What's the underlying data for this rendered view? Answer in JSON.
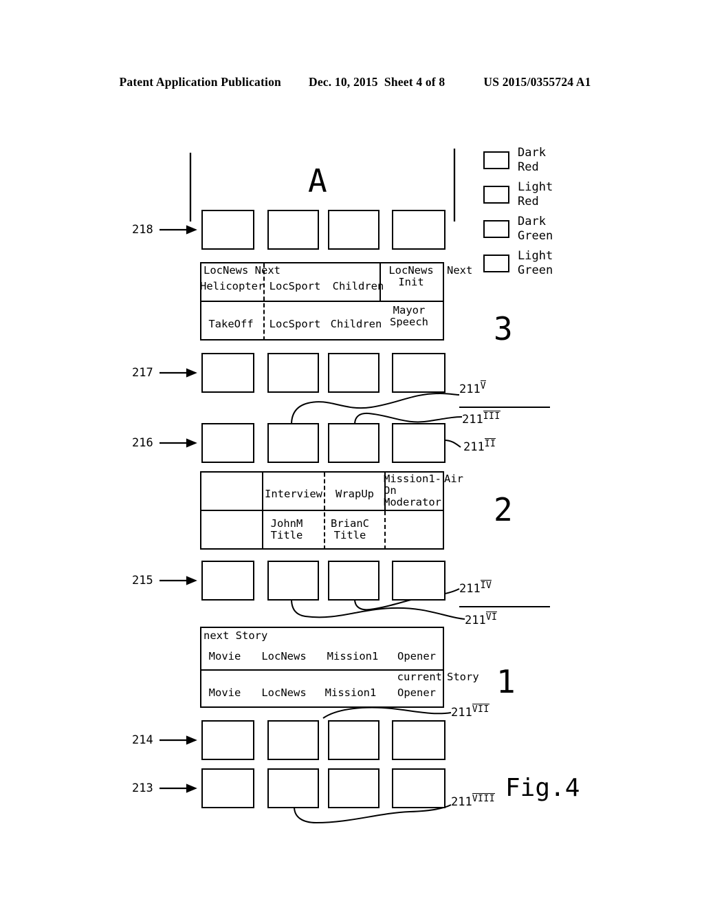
{
  "header": {
    "publication": "Patent Application Publication",
    "date": "Dec. 10, 2015",
    "sheet": "Sheet 4 of 8",
    "docnumber": "US 2015/0355724 A1"
  },
  "figure": {
    "label": "Fig.4",
    "group_letter": "A",
    "group_numbers": [
      "3",
      "2",
      "1"
    ]
  },
  "legend": {
    "items": [
      {
        "name": "dark-red",
        "label": "Dark\nRed",
        "pattern": "dark-red",
        "color": "#8b0000"
      },
      {
        "name": "light-red",
        "label": "Light\nRed",
        "pattern": "light-red",
        "color": "#ff6666"
      },
      {
        "name": "dark-green",
        "label": "Dark\nGreen",
        "pattern": "dark-green",
        "color": "#006400"
      },
      {
        "name": "light-green",
        "label": "Light\nGreen",
        "pattern": "light-green",
        "color": "#66cc66"
      }
    ]
  },
  "ref_numbers": {
    "left": [
      "218",
      "217",
      "216",
      "215",
      "214",
      "213"
    ],
    "callouts": [
      {
        "base": "211",
        "roman": "V"
      },
      {
        "base": "211",
        "roman": "III"
      },
      {
        "base": "211",
        "roman": "II"
      },
      {
        "base": "211",
        "roman": "IV"
      },
      {
        "base": "211",
        "roman": "VI"
      },
      {
        "base": "211",
        "roman": "VII"
      },
      {
        "base": "211",
        "roman": "VIII"
      }
    ]
  },
  "rows": {
    "r218": {
      "id": "218",
      "cells": [
        "light-green",
        "empty",
        "empty",
        "dark-green"
      ]
    },
    "r217": {
      "id": "217",
      "cells": [
        "dark-green",
        "light-green",
        "light-green",
        "dark-green"
      ]
    },
    "r216": {
      "id": "216",
      "cells": [
        "empty",
        "dark-red",
        "light-red",
        "light-red"
      ]
    },
    "r215": {
      "id": "215",
      "cells": [
        "empty",
        "light-red",
        "light-red",
        "empty"
      ]
    },
    "r214": {
      "id": "214",
      "cells": [
        "light-green",
        "dark-green",
        "light-green",
        "light-green"
      ]
    },
    "r213": {
      "id": "213",
      "cells": [
        "light-red",
        "light-red",
        "dark-red",
        "light-red"
      ]
    }
  },
  "table3": {
    "group": "3",
    "top_label": "LocNews Next",
    "right_outside": "Next",
    "top_row": [
      "Helicopter",
      "LocSport",
      "Children",
      "LocNews\nInit"
    ],
    "bottom_row": [
      "TakeOff",
      "LocSport",
      "Children",
      "Mayor\nSpeech"
    ]
  },
  "table2": {
    "group": "2",
    "right_outside": "Air",
    "top_row": [
      "",
      "Interview",
      "WrapUp",
      "Mission1-On\nModerator"
    ],
    "bottom_row": [
      "",
      "JohnM\nTitle",
      "BrianC\nTitle",
      ""
    ]
  },
  "table1": {
    "group": "1",
    "top_label": "next Story",
    "bottom_label": "current",
    "right_outside": "Story",
    "top_row": [
      "Movie",
      "LocNews",
      "Mission1",
      "Opener"
    ],
    "bottom_row": [
      "Movie",
      "LocNews",
      "Mission1",
      "Opener"
    ]
  }
}
